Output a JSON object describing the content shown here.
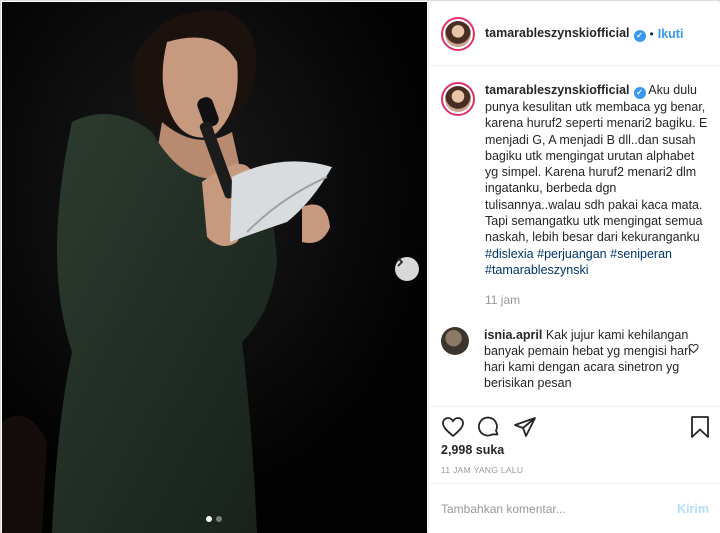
{
  "post": {
    "username": "tamarableszynskiofficial",
    "separator": "•",
    "follow_label": "Ikuti",
    "verified_icon": "verified-badge-icon"
  },
  "caption": {
    "username": "tamarableszynskiofficial",
    "text": " Aku dulu punya kesulitan utk membaca yg benar, karena huruf2 seperti menari2 bagiku. E menjadi G, A menjadi B dll..dan susah bagiku utk mengingat urutan alphabet yg simpel. Karena huruf2 menari2 dlm ingatanku, berbeda dgn tulisannya..walau sdh pakai kaca mata. Tapi semangatku utk mengingat semua naskah, lebih besar dari kekuranganku ",
    "hashtags": [
      "#dislexia",
      "#perjuangan",
      "#seniperan",
      "#tamarableszynski"
    ],
    "time": "11 jam"
  },
  "comments": [
    {
      "username": "isnia.april",
      "text": " Kak jujur kami kehilangan banyak pemain hebat yg mengisi hari hari kami dengan acara sinetron yg berisikan pesan"
    }
  ],
  "stats": {
    "likes": "2,998 suka",
    "timestamp": "11 JAM YANG LALU"
  },
  "add_comment": {
    "placeholder": "Tambahkan komentar...",
    "post_label": "Kirim"
  },
  "carousel": {
    "total_slides": 2,
    "active_slide": 1
  },
  "colors": {
    "link_blue": "#3897f0",
    "hashtag": "#003569",
    "muted": "#999999",
    "story_ring": "#e1306c"
  }
}
